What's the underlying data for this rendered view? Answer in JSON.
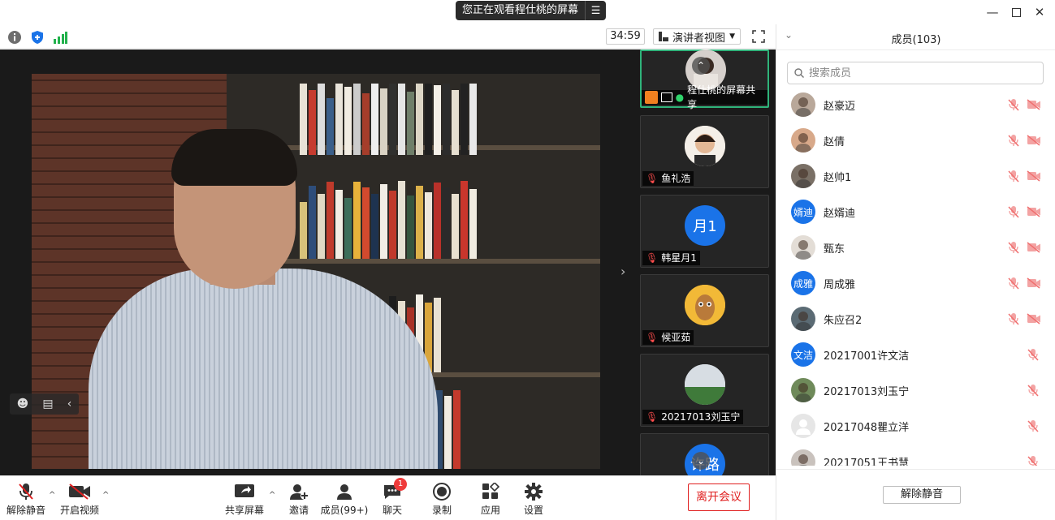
{
  "title_bar": {
    "share_banner": "您正在观看程仕桃的屏幕",
    "window_controls": [
      "minimize",
      "maximize",
      "close"
    ]
  },
  "top_bar": {
    "timer": "34:59",
    "view_mode": "演讲者视图",
    "icons": [
      "info-icon",
      "shield-icon",
      "signal-icon",
      "fullscreen-icon"
    ],
    "colors": {
      "shield": "#1a73e8",
      "signal": "#22b14c"
    }
  },
  "thumbnails": [
    {
      "name": "程仕桃的屏幕共享",
      "active": true,
      "avatar": "photo"
    },
    {
      "name": "鱼礼浩",
      "active": false,
      "avatar": "photo"
    },
    {
      "name": "韩星月1",
      "active": false,
      "avatar": "text",
      "avatar_text": "月1"
    },
    {
      "name": "候亚茹",
      "active": false,
      "avatar": "cartoon"
    },
    {
      "name": "20217013刘玉宁",
      "active": false,
      "avatar": "photo"
    },
    {
      "name": "",
      "active": false,
      "avatar": "text",
      "avatar_text": "许路"
    }
  ],
  "bottom_bar": {
    "unmute": "解除静音",
    "start_video": "开启视频",
    "share_screen": "共享屏幕",
    "invite": "邀请",
    "participants": "成员(99+)",
    "chat": "聊天",
    "chat_badge": "1",
    "record": "录制",
    "apps": "应用",
    "settings": "设置",
    "leave": "离开会议"
  },
  "panel": {
    "title": "成员(103)",
    "search_placeholder": "搜索成员",
    "mute_all": "解除静音",
    "members": [
      {
        "name": "赵豪迈",
        "avatar": "photo",
        "video": true
      },
      {
        "name": "赵倩",
        "avatar": "photo",
        "video": true
      },
      {
        "name": "赵帅1",
        "avatar": "photo",
        "video": true
      },
      {
        "name": "赵婿迪",
        "avatar": "text",
        "avatar_text": "婿迪",
        "video": true
      },
      {
        "name": "甄东",
        "avatar": "photo",
        "video": true
      },
      {
        "name": "周成雅",
        "avatar": "text",
        "avatar_text": "成雅",
        "video": true
      },
      {
        "name": "朱应召2",
        "avatar": "photo",
        "video": true
      },
      {
        "name": "20217001许文洁",
        "avatar": "text",
        "avatar_text": "文洁",
        "video": false
      },
      {
        "name": "20217013刘玉宁",
        "avatar": "photo",
        "video": false
      },
      {
        "name": "20217048瞿立洋",
        "avatar": "default",
        "video": false
      },
      {
        "name": "20217051王书慧",
        "avatar": "photo",
        "video": false
      }
    ]
  },
  "colors": {
    "accent_blue": "#1a73e8",
    "active_green": "#2fb37a",
    "muted_red": "#e02020"
  }
}
